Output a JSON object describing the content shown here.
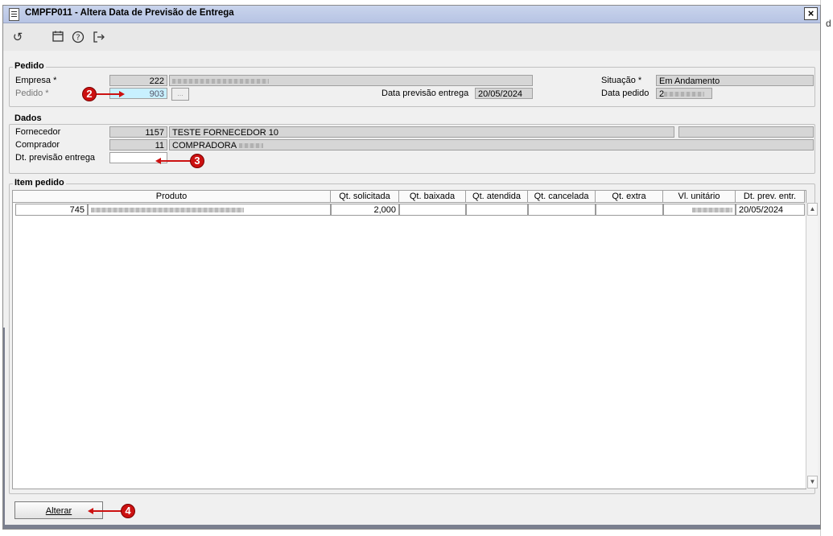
{
  "window": {
    "title": "CMPFP011 - Altera Data de Previsão de Entrega",
    "close": "×"
  },
  "outside": {
    "fragment": "d"
  },
  "toolbar": {
    "icons": [
      "refresh-icon",
      "calendar-icon",
      "help-icon",
      "exit-icon"
    ]
  },
  "pedido_group": {
    "title": "Pedido",
    "empresa_label": "Empresa *",
    "empresa_code": "222",
    "pedido_label": "Pedido *",
    "pedido_value": "903",
    "previsao_label": "Data previsão entrega",
    "previsao_value": "20/05/2024",
    "situacao_label": "Situação *",
    "situacao_value": "Em Andamento",
    "data_pedido_label": "Data pedido",
    "data_pedido_value": "2"
  },
  "dados_group": {
    "title": "Dados",
    "fornecedor_label": "Fornecedor",
    "fornecedor_code": "1157",
    "fornecedor_name": "TESTE FORNECEDOR 10",
    "comprador_label": "Comprador",
    "comprador_code": "11",
    "comprador_name": "COMPRADORA",
    "dt_previsao_label": "Dt. previsão entrega",
    "dt_previsao_value": ""
  },
  "item_group": {
    "title": "Item pedido",
    "columns": [
      "Produto",
      "Qt. solicitada",
      "Qt. baixada",
      "Qt. atendida",
      "Qt. cancelada",
      "Qt. extra",
      "Vl. unitário",
      "Dt. prev. entr."
    ],
    "row": {
      "code": "745",
      "qt_solicitada": "2,000",
      "qt_baixada": "",
      "qt_atendida": "",
      "qt_cancelada": "",
      "qt_extra": "",
      "dt_prev": "20/05/2024"
    }
  },
  "markers": [
    "2",
    "3",
    "4"
  ],
  "actions": {
    "alterar_label": "Alterar"
  },
  "colors": {
    "titlebar": "#b7c4e4",
    "marker": "#cc1111",
    "highlight_field": "#c8f0ff"
  }
}
